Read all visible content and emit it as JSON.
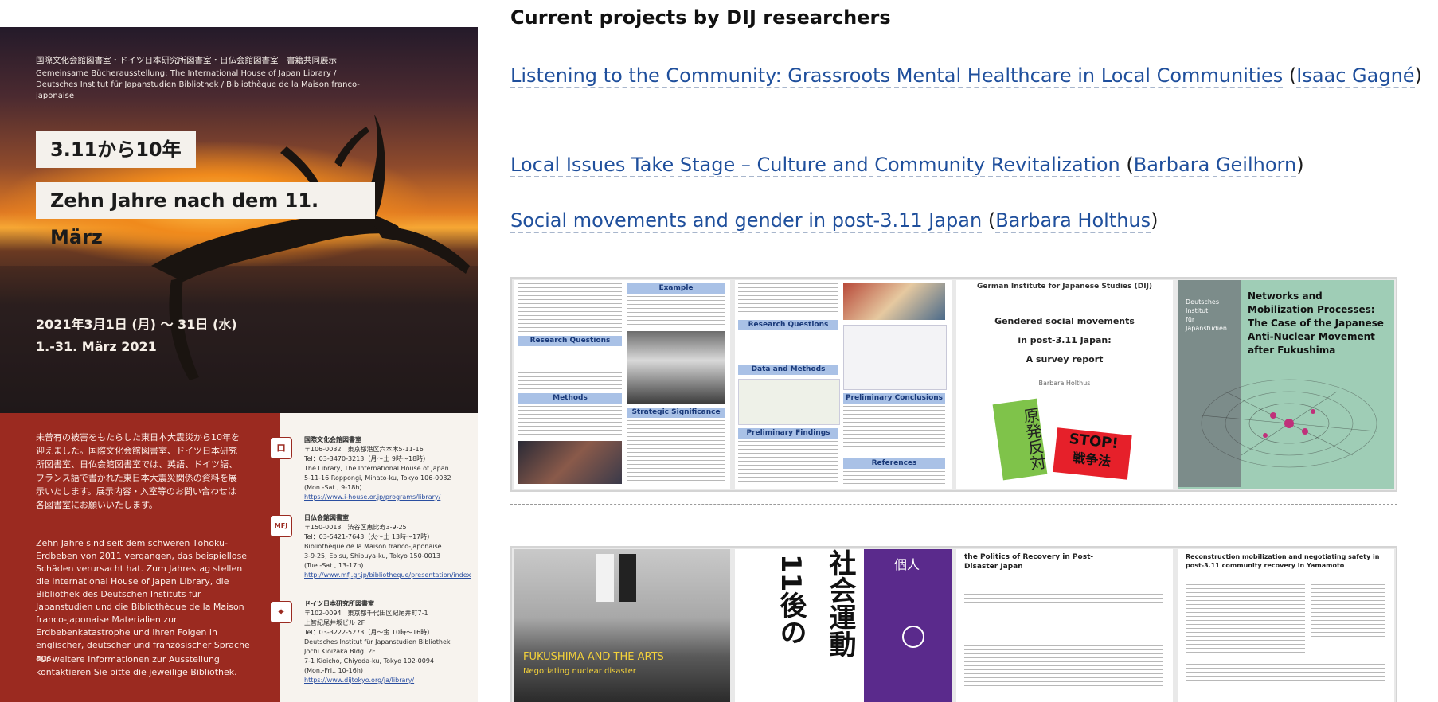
{
  "heading": "Current projects by DIJ researchers",
  "projects": [
    {
      "title": "Listening to the Community: Grassroots Mental Healthcare in Local Communities",
      "author": "Isaac Gagné"
    },
    {
      "title": "Local Issues Take Stage – Culture and Community Revitalization",
      "author": "Barbara Geilhorn"
    },
    {
      "title": "Social movements and gender in post-3.11 Japan",
      "author": "Barbara Holthus"
    }
  ],
  "poster": {
    "header_jp": "国際文化会館図書室・ドイツ日本研究所図書室・日仏会館図書室　書籍共同展示",
    "header_de_1": "Gemeinsame Bücherausstellung: The International House of Japan Library /",
    "header_de_2": "Deutsches Institut für Japanstudien Bibliothek / Bibliothèque de la Maison franco-japonaise",
    "title_jp": "3.11から10年",
    "title_de": "Zehn Jahre nach dem 11. März",
    "date_jp": "2021年3月1日 (月) 〜 31日 (水)",
    "date_de": "1.-31. März 2021",
    "text_jp": "未曾有の被害をもたらした東日本大震災から10年を迎えました。国際文化会館図書室、ドイツ日本研究所図書室、日仏会館図書室では、英語、ドイツ語、フランス語で書かれた東日本大震災関係の資料を展示いたします。展示内容・入室等のお問い合わせは各図書室にお願いいたします。",
    "text_de": "Zehn Jahre sind seit dem schweren Tōhoku-Erdbeben von 2011 vergangen, das beispiellose Schäden verursacht hat. Zum Jahrestag stellen die International House of Japan Library, die Bibliothek des Deutschen Instituts für Japanstudien und die Bibliothèque de la Maison franco-japonaise Materialien zur Erdbebenkatastrophe und ihren Folgen in englischer, deutscher und französischer Sprache aus.",
    "text_more": "Für weitere Informationen zur Ausstellung kontaktieren Sie bitte die jeweilige Bibliothek.",
    "institutions": [
      {
        "logo": "ロ",
        "lines": [
          "国際文化会館図書室",
          "〒106-0032　東京都港区六本木5-11-16",
          "Tel：03-3470-3213（月〜土 9時〜18時）",
          "The Library, The International House of Japan",
          "5-11-16 Roppongi, Minato-ku, Tokyo 106-0032",
          "(Mon.-Sat., 9-18h)"
        ],
        "link": "https://www.i-house.or.jp/programs/library/"
      },
      {
        "logo": "MFJ",
        "lines": [
          "日仏会館図書室",
          "〒150-0013　渋谷区恵比寿3-9-25",
          "Tel：03-5421-7643（火〜土 13時〜17時）",
          "Bibliothèque de la Maison franco-japonaise",
          "3-9-25, Ebisu, Shibuya-ku, Tokyo 150-0013",
          "(Tue.-Sat., 13-17h)"
        ],
        "link": "http://www.mfj.gr.jp/bibliotheque/presentation/index_ja.php"
      },
      {
        "logo": "✦",
        "lines": [
          "ドイツ日本研究所図書室",
          "〒102-0094　東京都千代田区紀尾井町7-1",
          "上智紀尾井坂ビル 2F",
          "Tel：03-3222-5273（月〜金 10時〜16時）",
          "Deutsches Institut für Japanstudien Bibliothek",
          "Jochi Kioizaka Bldg. 2F",
          "7-1 Kioicho, Chiyoda-ku, Tokyo 102-0094",
          "(Mon.-Fri., 10-16h)"
        ],
        "link": "https://www.dijtokyo.org/ja/library/"
      }
    ]
  },
  "gallery1": {
    "poster1_heading_1": "Example",
    "poster1_heading_2": "Research Questions",
    "poster1_heading_3": "Methods",
    "poster1_heading_4": "Strategic Significance",
    "poster2_heading_1": "Research Questions",
    "poster2_heading_2": "Data and Methods",
    "poster2_heading_3": "Preliminary Findings",
    "poster2_heading_4": "Preliminary Conclusions",
    "poster2_heading_5": "References",
    "report_header": "German Institute for Japanese Studies (DIJ)",
    "report_title_1": "Gendered social movements",
    "report_title_2": "in post-3.11 Japan:",
    "report_title_3": "A survey report",
    "report_author": "Barbara Holthus",
    "sign_green": "原発反対",
    "sign_red_1": "STOP!",
    "sign_red_2": "戦争法",
    "dij_label_1": "Deutsches",
    "dij_label_2": "Institut",
    "dij_label_3": "für",
    "dij_label_4": "Japanstudien",
    "networks_title": "Networks and Mobilization Processes: The Case of the Japanese Anti-Nuclear Movement after Fukushima"
  },
  "gallery2": {
    "book_title": "FUKUSHIMA AND THE ARTS",
    "book_subtitle": "Negotiating nuclear disaster",
    "jp_book_1": "11後の",
    "jp_book_2": "社会運動",
    "jp_book_3": "個人",
    "paper1_title": "the Politics of Recovery in Post-Disaster Japan",
    "paper2_title": "Reconstruction mobilization and negotiating safety in post-3.11 community recovery in Yamamoto"
  },
  "colors": {
    "link": "#1f4f9c",
    "poster_red": "#9b2a20"
  }
}
